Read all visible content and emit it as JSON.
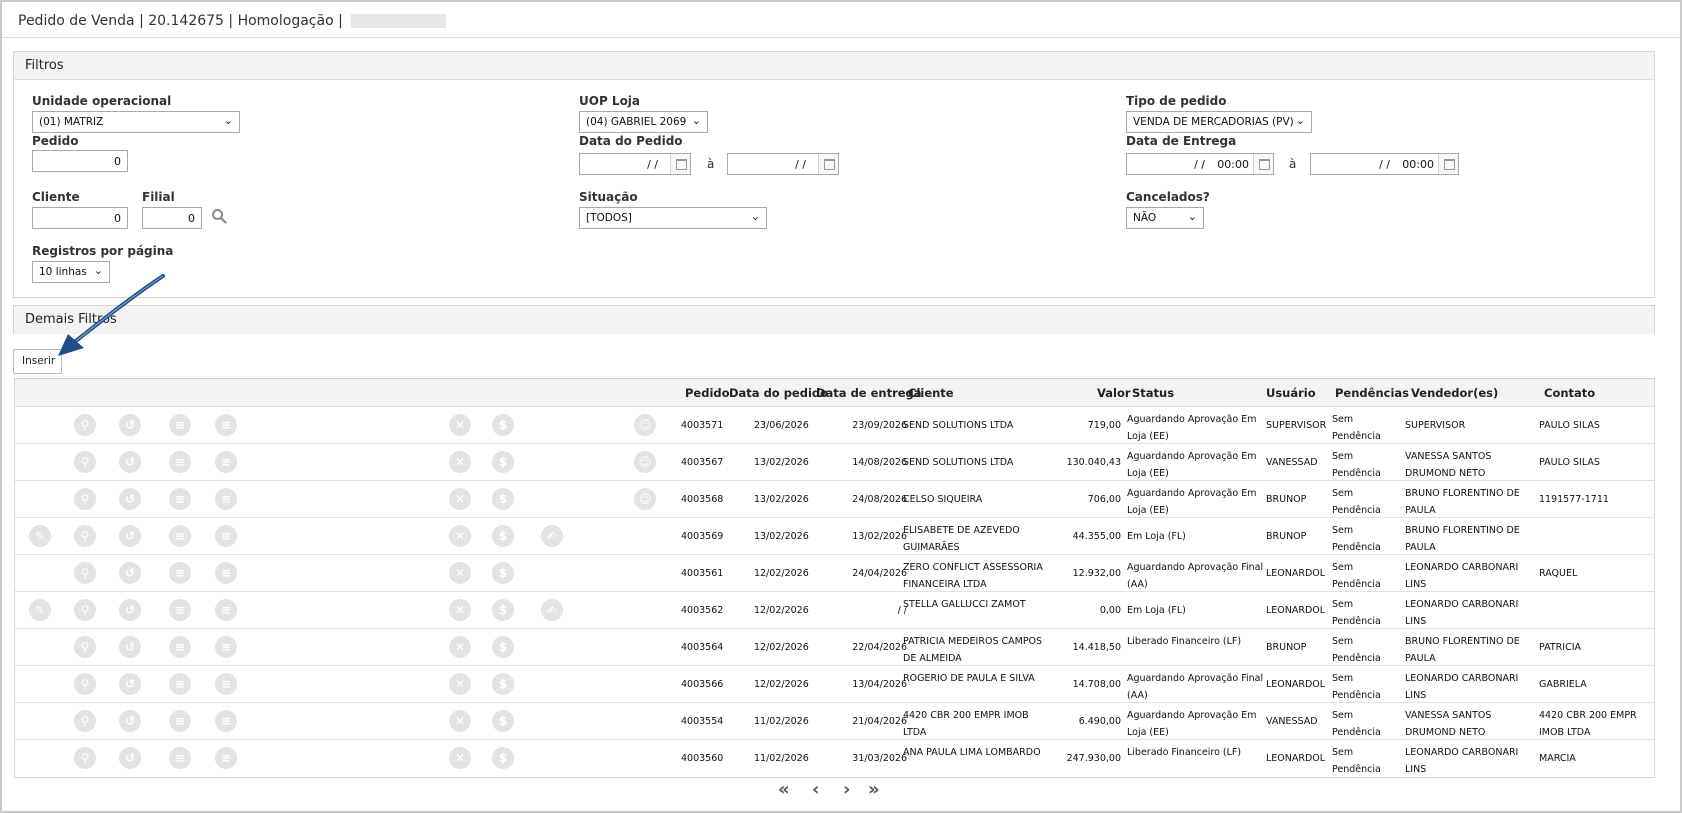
{
  "title": {
    "text": "Pedido de Venda | 20.142675 | Homologação |"
  },
  "filtros": {
    "header": "Filtros",
    "unidade_label": "Unidade operacional",
    "unidade_value": "(01) MATRIZ",
    "pedido_label": "Pedido",
    "pedido_value": "0",
    "cliente_label": "Cliente",
    "cliente_value": "0",
    "filial_label": "Filial",
    "filial_value": "0",
    "registros_label": "Registros por página",
    "registros_value": "10 linhas",
    "uop_label": "UOP Loja",
    "uop_value": "(04) GABRIEL 2069",
    "data_pedido_label": "Data do Pedido",
    "date_empty": "/ /",
    "a_sep": "à",
    "situacao_label": "Situação",
    "situacao_value": "[TODOS]",
    "tipo_label": "Tipo de pedido",
    "tipo_value": "VENDA DE MERCADORIAS (PV)",
    "data_entrega_label": "Data de Entrega",
    "time_value": "00:00",
    "cancelados_label": "Cancelados?",
    "cancelados_value": "NÃO"
  },
  "demais": {
    "header": "Demais Filtros"
  },
  "toolbar": {
    "inserir_label": "Inserir"
  },
  "table": {
    "headers": {
      "pedido": "Pedido",
      "data_pedido": "Data do pedido",
      "data_entrega": "Data de entrega",
      "cliente": "Cliente",
      "valor": "Valor",
      "status": "Status",
      "usuario": "Usuário",
      "pendencias": "Pendências",
      "vendedor": "Vendedor(es)",
      "contato": "Contato"
    },
    "rows": [
      {
        "pedido": "4003571",
        "data_pedido": "23/06/2026",
        "data_entrega": "23/09/2026",
        "cliente": "SEND SOLUTIONS LTDA",
        "valor": "719,00",
        "status": "Aguardando Aprovação Em Loja (EE)",
        "usuario": "SUPERVISOR",
        "pendencias": "Sem Pendência",
        "vendedor": "SUPERVISOR",
        "contato": "PAULO SILAS"
      },
      {
        "pedido": "4003567",
        "data_pedido": "13/02/2026",
        "data_entrega": "14/08/2026",
        "cliente": "SEND SOLUTIONS LTDA",
        "valor": "130.040,43",
        "status": "Aguardando Aprovação Em Loja (EE)",
        "usuario": "VANESSAD",
        "pendencias": "Sem Pendência",
        "vendedor": "VANESSA SANTOS DRUMOND NETO",
        "contato": "PAULO SILAS"
      },
      {
        "pedido": "4003568",
        "data_pedido": "13/02/2026",
        "data_entrega": "24/08/2026",
        "cliente": "CELSO SIQUEIRA",
        "valor": "706,00",
        "status": "Aguardando Aprovação Em Loja (EE)",
        "usuario": "BRUNOP",
        "pendencias": "Sem Pendência",
        "vendedor": "BRUNO FLORENTINO DE PAULA",
        "contato": "1191577-1711"
      },
      {
        "pedido": "4003569",
        "data_pedido": "13/02/2026",
        "data_entrega": "13/02/2026",
        "cliente": "ELISABETE DE AZEVEDO GUIMARÃES",
        "valor": "44.355,00",
        "status": "Em Loja (FL)",
        "usuario": "BRUNOP",
        "pendencias": "Sem Pendência",
        "vendedor": "BRUNO FLORENTINO DE PAULA",
        "contato": ""
      },
      {
        "pedido": "4003561",
        "data_pedido": "12/02/2026",
        "data_entrega": "24/04/2026",
        "cliente": "ZERO CONFLICT ASSESSORIA FINANCEIRA LTDA",
        "valor": "12.932,00",
        "status": "Aguardando Aprovação Final (AA)",
        "usuario": "LEONARDOL",
        "pendencias": "Sem Pendência",
        "vendedor": "LEONARDO CARBONARI LINS",
        "contato": "RAQUEL"
      },
      {
        "pedido": "4003562",
        "data_pedido": "12/02/2026",
        "data_entrega": "/ /",
        "cliente": "STELLA GALLUCCI ZAMOT",
        "valor": "0,00",
        "status": "Em Loja (FL)",
        "usuario": "LEONARDOL",
        "pendencias": "Sem Pendência",
        "vendedor": "LEONARDO CARBONARI LINS",
        "contato": ""
      },
      {
        "pedido": "4003564",
        "data_pedido": "12/02/2026",
        "data_entrega": "22/04/2026",
        "cliente": "PATRICIA MEDEIROS CAMPOS DE ALMEIDA",
        "valor": "14.418,50",
        "status": "Liberado Financeiro (LF)",
        "usuario": "BRUNOP",
        "pendencias": "Sem Pendência",
        "vendedor": "BRUNO FLORENTINO DE PAULA",
        "contato": "PATRICIA"
      },
      {
        "pedido": "4003566",
        "data_pedido": "12/02/2026",
        "data_entrega": "13/04/2026",
        "cliente": "ROGERIO DE PAULA E SILVA",
        "valor": "14.708,00",
        "status": "Aguardando Aprovação Final (AA)",
        "usuario": "LEONARDOL",
        "pendencias": "Sem Pendência",
        "vendedor": "LEONARDO CARBONARI LINS",
        "contato": "GABRIELA"
      },
      {
        "pedido": "4003554",
        "data_pedido": "11/02/2026",
        "data_entrega": "21/04/2026",
        "cliente": "4420 CBR 200 EMPR IMOB LTDA",
        "valor": "6.490,00",
        "status": "Aguardando Aprovação Em Loja (EE)",
        "usuario": "VANESSAD",
        "pendencias": "Sem Pendência",
        "vendedor": "VANESSA SANTOS DRUMOND NETO",
        "contato": "4420 CBR 200 EMPR IMOB LTDA"
      },
      {
        "pedido": "4003560",
        "data_pedido": "11/02/2026",
        "data_entrega": "31/03/2026",
        "cliente": "ANA PAULA LIMA LOMBARDO",
        "valor": "247.930,00",
        "status": "Liberado Financeiro (LF)",
        "usuario": "LEONARDOL",
        "pendencias": "Sem Pendência",
        "vendedor": "LEONARDO CARBONARI LINS",
        "contato": "MARCIA"
      }
    ]
  },
  "pager": {
    "first": "«",
    "prev": "‹",
    "next": "›",
    "last": "»"
  },
  "colors": {
    "icon_bg": "#e3e3e3",
    "arrow": "#1f4e8c",
    "panel_head": "#f3f3f3",
    "title_sep": "#f0a020"
  }
}
